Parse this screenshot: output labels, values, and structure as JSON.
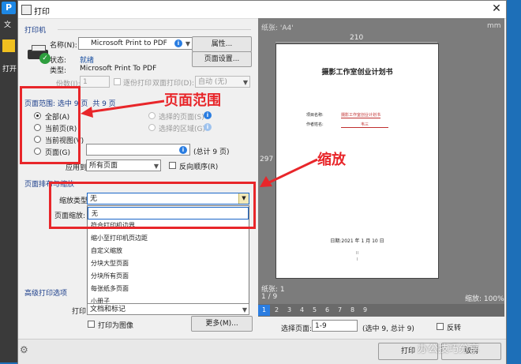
{
  "window": {
    "title": "打印",
    "close": "✕"
  },
  "bg": {
    "logo": "P",
    "menu": "文",
    "open": "打开"
  },
  "printer": {
    "section": "打印机",
    "name_label": "名称(N):",
    "name_value": "Microsoft Print to PDF",
    "properties": "属性...",
    "status_label": "状态:",
    "status_value": "就绪",
    "type_label": "类型:",
    "type_value": "Microsoft Print To PDF",
    "page_setup": "页面设置...",
    "copies_label": "份数(I):",
    "copies_value": "1",
    "collate": "逐份打印",
    "duplex_label": "双面打印(D):",
    "duplex_value": "自动 (无)"
  },
  "range": {
    "header_a": "页面范围: 选中 9 页",
    "header_b": "共 9 页",
    "all": "全部(A)",
    "current": "当前页(R)",
    "current_view": "当前视图(V)",
    "pages": "页面(G)",
    "selected_pages": "选择的页面(S)",
    "selected_area": "选择的区域(G)",
    "total": "(总计 9 页)",
    "apply_label": "应用到:",
    "apply_value": "所有页面",
    "reverse": "反向顺序(R)"
  },
  "zoom": {
    "section": "页面排布与缩放",
    "type_label": "缩放类型:",
    "type_value": "无",
    "page_zoom_label": "页面缩放:",
    "options": [
      "无",
      "符合打印机边界",
      "缩小至打印机页边距",
      "自定义缩放",
      "分块大型页面",
      "分块所有页面",
      "每张纸多页面",
      "小册子"
    ]
  },
  "advanced": {
    "section": "高级打印选项",
    "print_label": "打印",
    "print_value": "文档和标记",
    "as_image": "打印为图像",
    "more": "更多(M)..."
  },
  "preview": {
    "paper_label": "纸张: 'A4'",
    "unit": "mm",
    "width": "210",
    "height": "297",
    "doc_title": "摄影工作室创业计划书",
    "project_label": "项目名称:",
    "project_value": "摄影工作室创业计划书",
    "author_label": "作者姓名:",
    "author_value": "韦三",
    "date_line": "日期:2021 年 1 月 10 日",
    "small_mark": "II",
    "small_mark2": "I",
    "page_info": "纸张: 1",
    "page_of": "1 / 9",
    "zoom_info": "缩放: 100%",
    "page_numbers": [
      "1",
      "2",
      "3",
      "4",
      "5",
      "6",
      "7",
      "8",
      "9"
    ],
    "select_label": "选择页面:",
    "select_value": "1-9",
    "select_info": "(选中 9, 总计 9)",
    "reverse": "反转"
  },
  "buttons": {
    "print": "打印",
    "cancel": "取消"
  },
  "annotations": {
    "range": "页面范围",
    "zoom": "缩放"
  },
  "watermark": "办公技巧分享",
  "colors": {
    "accent": "#e8262a",
    "primary": "#2a7de1"
  }
}
